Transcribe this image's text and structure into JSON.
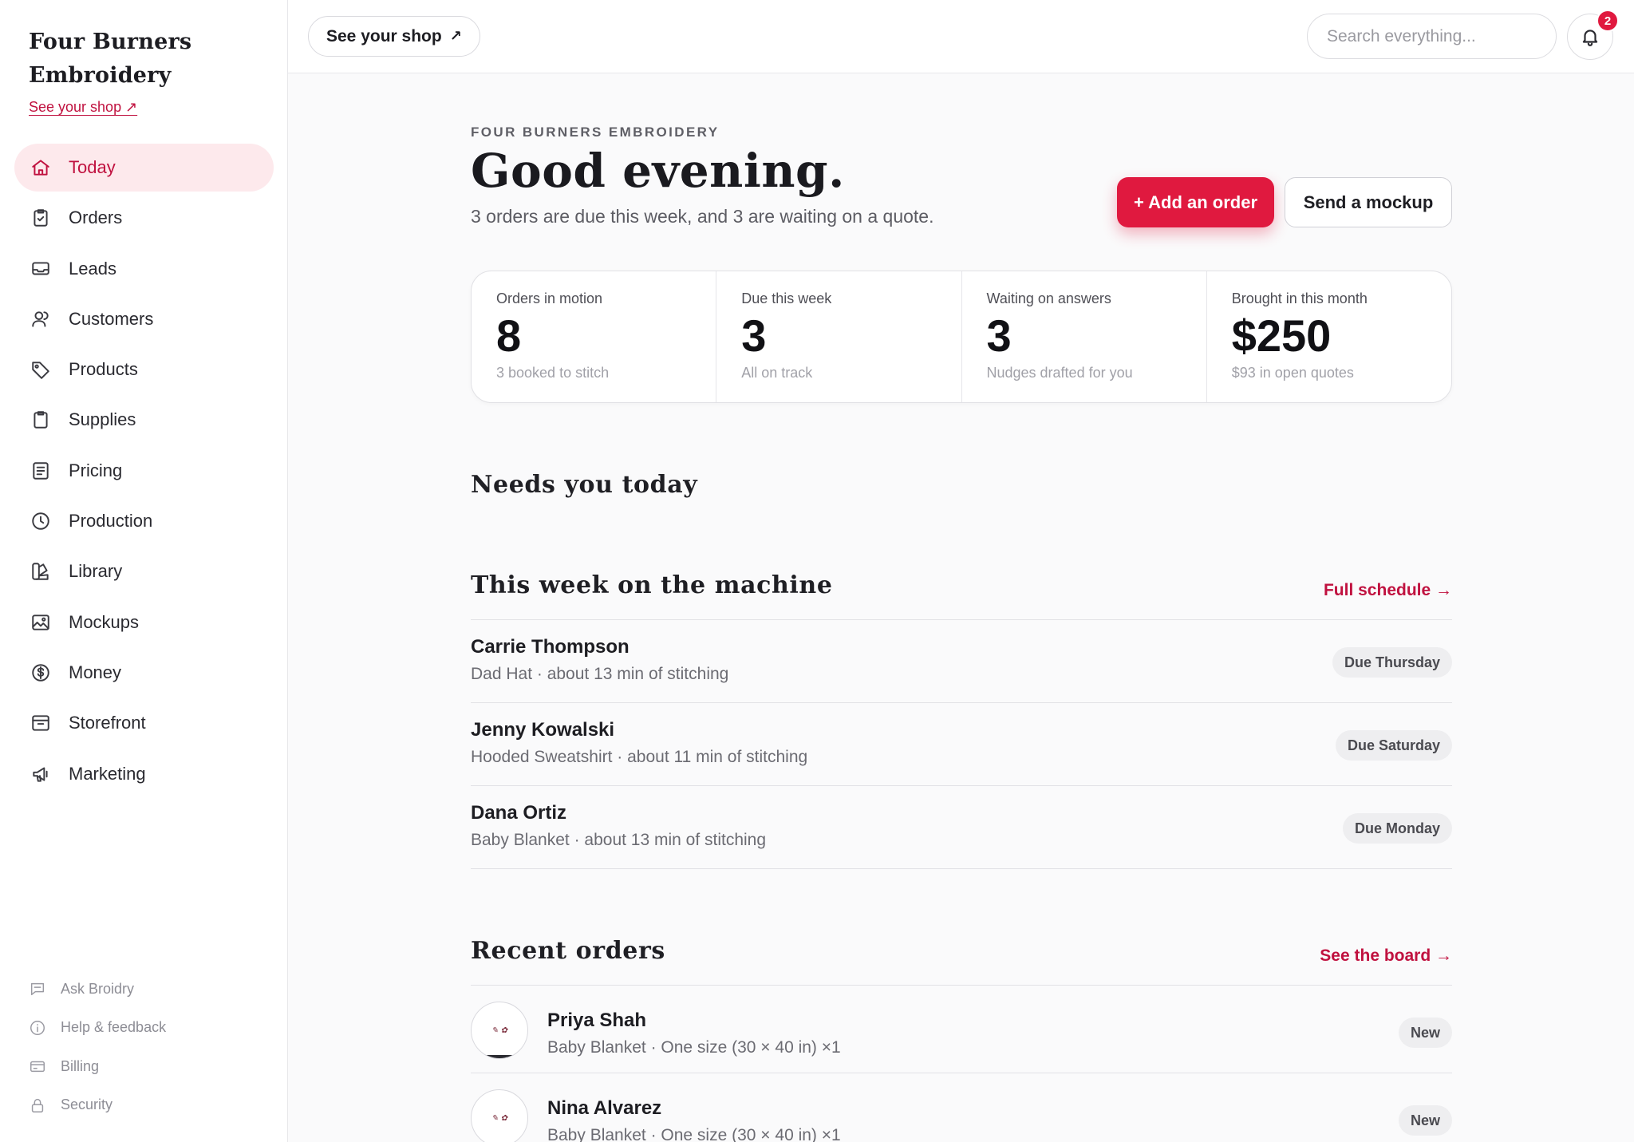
{
  "sidebar": {
    "brand_line1": "Four Burners",
    "brand_line2": "Embroidery",
    "shop_link": "See your shop ↗",
    "items": [
      {
        "label": "Today",
        "icon": "home-icon",
        "active": true
      },
      {
        "label": "Orders",
        "icon": "clipboard-check-icon"
      },
      {
        "label": "Leads",
        "icon": "inbox-icon"
      },
      {
        "label": "Customers",
        "icon": "users-icon"
      },
      {
        "label": "Products",
        "icon": "tag-icon"
      },
      {
        "label": "Supplies",
        "icon": "clipboard-icon"
      },
      {
        "label": "Pricing",
        "icon": "receipt-icon"
      },
      {
        "label": "Production",
        "icon": "clock-icon"
      },
      {
        "label": "Library",
        "icon": "swatch-icon"
      },
      {
        "label": "Mockups",
        "icon": "image-icon"
      },
      {
        "label": "Money",
        "icon": "dollar-circle-icon"
      },
      {
        "label": "Storefront",
        "icon": "store-icon"
      },
      {
        "label": "Marketing",
        "icon": "megaphone-icon"
      }
    ],
    "footer": [
      {
        "label": "Ask Broidry",
        "icon": "chat-icon"
      },
      {
        "label": "Help & feedback",
        "icon": "info-icon"
      },
      {
        "label": "Billing",
        "icon": "credit-card-icon"
      },
      {
        "label": "Security",
        "icon": "lock-icon"
      }
    ]
  },
  "topbar": {
    "shop_button": "See your shop",
    "shop_button_arrow": "↗",
    "search_placeholder": "Search everything...",
    "notification_count": "2"
  },
  "header": {
    "eyebrow": "FOUR BURNERS EMBROIDERY",
    "greeting": "Good evening.",
    "subline": "3 orders are due this week, and 3 are waiting on a quote.",
    "add_order": "+ Add an order",
    "send_mockup": "Send a mockup"
  },
  "stats": [
    {
      "label": "Orders in motion",
      "value": "8",
      "note": "3 booked to stitch"
    },
    {
      "label": "Due this week",
      "value": "3",
      "note": "All on track"
    },
    {
      "label": "Waiting on answers",
      "value": "3",
      "note": "Nudges drafted for you"
    },
    {
      "label": "Brought in this month",
      "value": "$250",
      "note": "$93 in open quotes"
    }
  ],
  "needs_today": {
    "title": "Needs you today"
  },
  "machine": {
    "title": "This week on the machine",
    "link": "Full schedule →",
    "rows": [
      {
        "name": "Carrie Thompson",
        "detail": "Dad Hat · about 13 min of stitching",
        "due": "Due Thursday"
      },
      {
        "name": "Jenny Kowalski",
        "detail": "Hooded Sweatshirt · about 11 min of stitching",
        "due": "Due Saturday"
      },
      {
        "name": "Dana Ortiz",
        "detail": "Baby Blanket · about 13 min of stitching",
        "due": "Due Monday"
      }
    ]
  },
  "recent": {
    "title": "Recent orders",
    "link": "See the board →",
    "rows": [
      {
        "name": "Priya Shah",
        "detail": "Baby Blanket · One size (30 × 40 in) ×1",
        "status": "New"
      },
      {
        "name": "Nina Alvarez",
        "detail": "Baby Blanket · One size (30 × 40 in) ×1",
        "status": "New"
      }
    ]
  },
  "colors": {
    "accent": "#e0193f",
    "accent_text": "#c0113f",
    "active_bg": "#fde9ec"
  }
}
